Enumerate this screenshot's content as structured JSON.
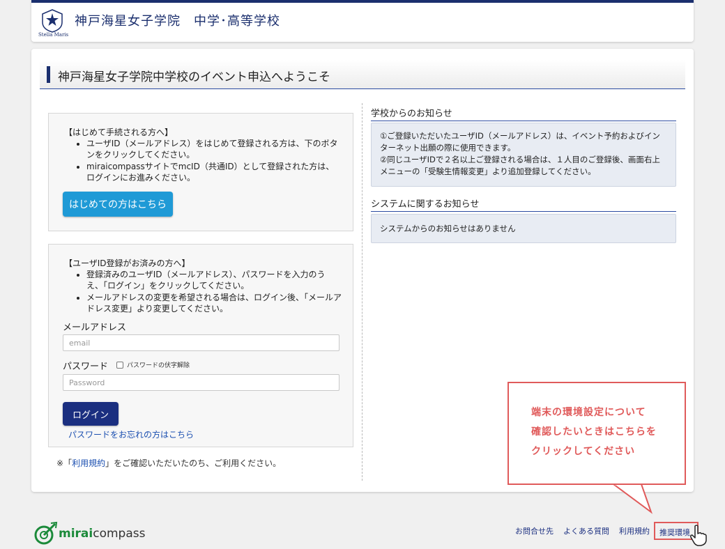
{
  "header": {
    "school_name": "神戸海星女子学院　中学･高等学校",
    "logo_sub": "Stella Maris"
  },
  "title": "神戸海星女子学院中学校のイベント申込へようこそ",
  "first_time": {
    "heading": "【はじめて手続される方へ】",
    "notes": [
      "ユーザID（メールアドレス）をはじめて登録される方は、下のボタンをクリックしてください。",
      "miraicompassサイトでmcID（共通ID）として登録された方は、ログインにお進みください。"
    ],
    "button": "はじめての方はこちら"
  },
  "registered": {
    "heading": "【ユーザID登録がお済みの方へ】",
    "notes": [
      "登録済みのユーザID（メールアドレス）、パスワードを入力のうえ、「ログイン」をクリックしてください。",
      "メールアドレスの変更を希望される場合は、ログイン後、「メールアドレス変更」より変更してください。"
    ],
    "email_label": "メールアドレス",
    "email_placeholder": "email",
    "password_label": "パスワード",
    "show_password_label": "パスワードの伏字解除",
    "password_placeholder": "Password",
    "login_button": "ログイン",
    "forgot_link": "パスワードをお忘れの方はこちら"
  },
  "terms": {
    "prefix": "※「",
    "link": "利用規約",
    "suffix": "」をご確認いただいたのち、ご利用ください。"
  },
  "school_notices": {
    "title": "学校からのお知らせ",
    "lines": [
      "①ご登録いただいたユーザID（メールアドレス）は、イベント予約およびインターネット出願の際に使用できます。",
      "②同じユーザIDで２名以上ご登録される場合は、１人目のご登録後、画面右上メニューの「受験生情報変更」より追加登録してください。"
    ]
  },
  "system_notices": {
    "title": "システムに関するお知らせ",
    "text": "システムからのお知らせはありません"
  },
  "callout": {
    "lines": [
      "端末の環境設定について",
      "確認したいときはこちらを",
      "クリックしてください"
    ]
  },
  "footer": {
    "brand_bold": "mirai",
    "brand_rest": "compass",
    "links": [
      "お問合せ先",
      "よくある質問",
      "利用規約",
      "推奨環境"
    ]
  },
  "colors": {
    "navy": "#1b2f6e",
    "button_blue": "#1f9ad6",
    "login_blue": "#1b2f80",
    "callout_red": "#e05a5a",
    "brand_green": "#1b8a3a"
  }
}
